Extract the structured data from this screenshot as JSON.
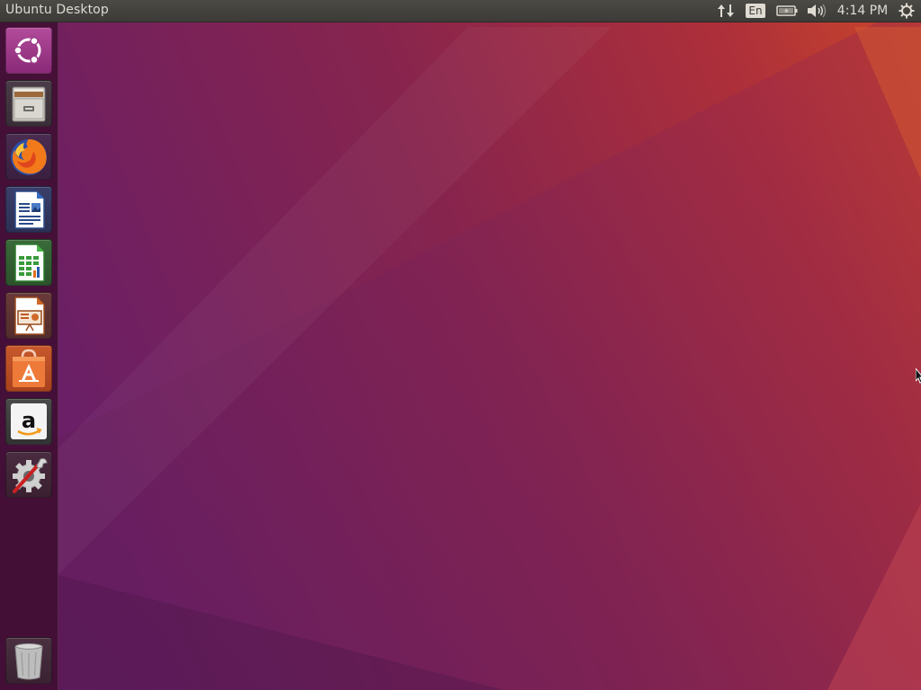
{
  "top_panel": {
    "window_title": "Ubuntu Desktop",
    "keyboard_layout": "En",
    "clock": "4:14 PM",
    "icons": {
      "network": "network-transfer-icon",
      "battery": "battery-icon",
      "sound": "volume-icon",
      "session": "gear-icon"
    }
  },
  "launcher": {
    "items": [
      {
        "name": "Search your computer",
        "icon": "ubuntu-dash-icon"
      },
      {
        "name": "Files",
        "icon": "file-cabinet-icon"
      },
      {
        "name": "Firefox Web Browser",
        "icon": "firefox-icon"
      },
      {
        "name": "LibreOffice Writer",
        "icon": "writer-document-icon"
      },
      {
        "name": "LibreOffice Calc",
        "icon": "calc-spreadsheet-icon"
      },
      {
        "name": "LibreOffice Impress",
        "icon": "impress-presentation-icon"
      },
      {
        "name": "Ubuntu Software",
        "icon": "software-bag-icon"
      },
      {
        "name": "Amazon",
        "icon": "amazon-icon"
      },
      {
        "name": "System Settings",
        "icon": "settings-wrench-icon"
      },
      {
        "name": "Trash",
        "icon": "trash-icon"
      }
    ]
  },
  "colors": {
    "panel": "#3c3b37",
    "panel_text": "#dfdbd2",
    "wallpaper_purple": "#6e1f5e",
    "wallpaper_orange": "#c8432a"
  }
}
